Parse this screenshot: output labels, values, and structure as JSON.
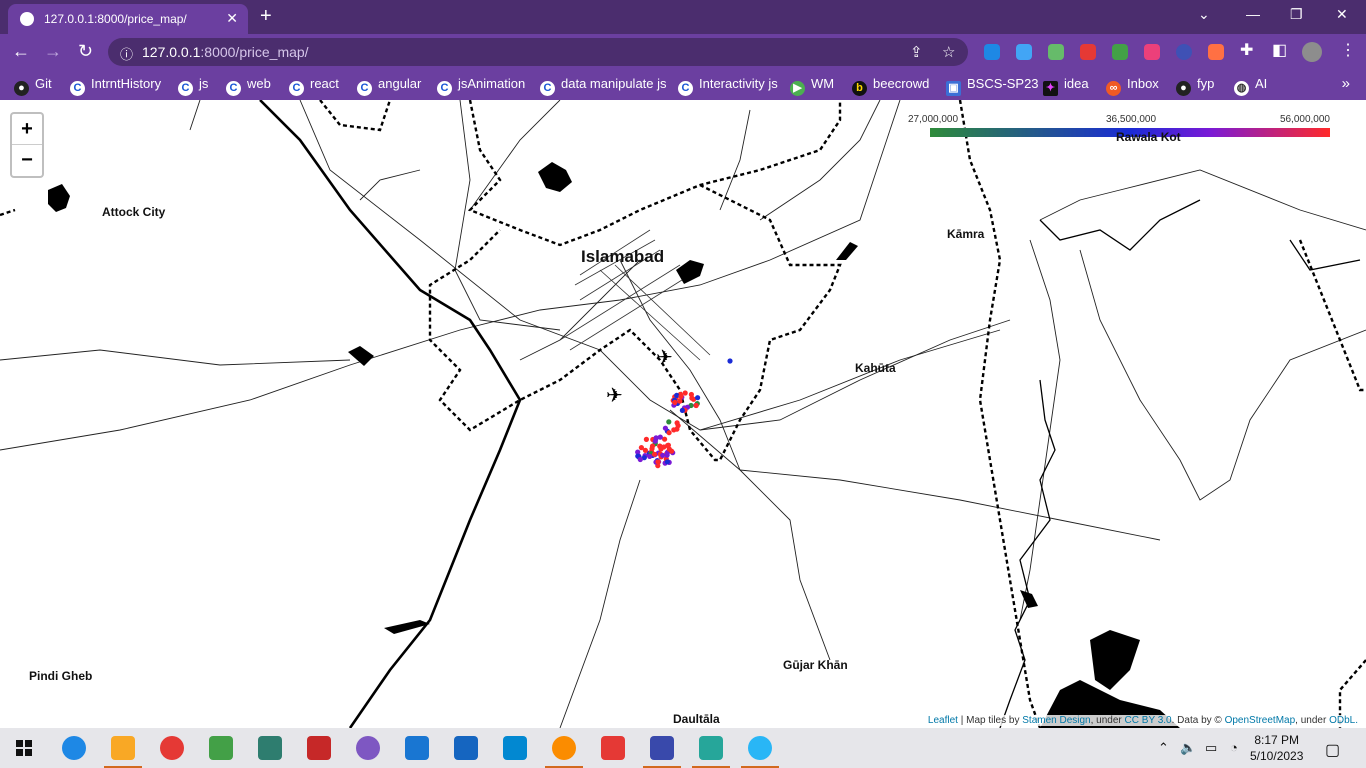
{
  "browser": {
    "tab_title": "127.0.0.1:8000/price_map/",
    "tab_close": "✕",
    "new_tab": "+",
    "url_host": "127.0.0.1",
    "url_rest": ":8000/price_map/",
    "window_controls": {
      "minimize": "—",
      "restore": "❐",
      "close": "✕",
      "tab_search": "⌄"
    }
  },
  "bookmarks": [
    {
      "label": "Git",
      "icon": "github-icon"
    },
    {
      "label": "IntrntHistory",
      "icon": "c-icon"
    },
    {
      "label": "js",
      "icon": "c-icon"
    },
    {
      "label": "web",
      "icon": "c-icon"
    },
    {
      "label": "react",
      "icon": "c-icon"
    },
    {
      "label": "angular",
      "icon": "c-icon"
    },
    {
      "label": "jsAnimation",
      "icon": "c-icon"
    },
    {
      "label": "data manipulate js",
      "icon": "c-icon"
    },
    {
      "label": "Interactivity js",
      "icon": "c-icon"
    },
    {
      "label": "WM",
      "icon": "play-icon"
    },
    {
      "label": "beecrowd",
      "icon": "beecrowd-icon"
    },
    {
      "label": "BSCS-SP23",
      "icon": "bscs-icon"
    },
    {
      "label": "idea",
      "icon": "idea-icon"
    },
    {
      "label": "Inbox",
      "icon": "inbox-icon"
    },
    {
      "label": "fyp",
      "icon": "github-icon"
    },
    {
      "label": "AI",
      "icon": "globe-icon"
    }
  ],
  "map": {
    "zoom_in": "+",
    "zoom_out": "−",
    "legend": {
      "min": "27,000,000",
      "mid": "36,500,000",
      "max": "56,000,000",
      "colors": [
        "#2e8b3a",
        "#1a2bd6",
        "#7a1ad6",
        "#ff2a2a"
      ]
    },
    "places": [
      "Attock City",
      "Islamabad",
      "Kāmra",
      "Kahūta",
      "Rawala Kot",
      "Pindi Gheb",
      "Gūjar Khān",
      "Daultāla"
    ],
    "attribution": {
      "leaflet": "Leaflet",
      "text1": " | Map tiles by ",
      "stamen": "Stamen Design",
      "text2": ", under ",
      "ccby": "CC BY 3.0",
      "text3": ". Data by © ",
      "osm": "OpenStreetMap",
      "text4": ", under ",
      "odbl": "ODbL."
    }
  },
  "taskbar": {
    "time": "8:17 PM",
    "date": "5/10/2023"
  }
}
